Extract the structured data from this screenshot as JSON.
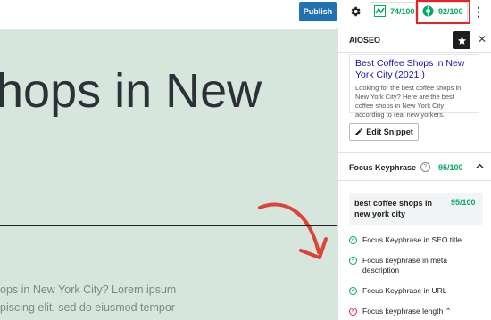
{
  "toolbar": {
    "publish_label": "Publish",
    "settings_icon": "gear-icon",
    "truseo_score": "74/100",
    "aioseo_score": "92/100",
    "more_icon": "kebab-icon",
    "highlight_color": "#e3242b"
  },
  "canvas": {
    "heading": "hops in New",
    "body_line1": "ops in New York City? Lorem ipsum",
    "body_line2": "piscing elit, sed do eiusmod tempor",
    "background_color": "#d7e6dc"
  },
  "sidebar": {
    "title": "AIOSEO",
    "snippet": {
      "title": "Best Coffee Shops in New York City (2021 )",
      "description": "Looking for the best coffee shops in New York City? Here are the best coffee shops in New York City according to real new yorkers."
    },
    "edit_snippet_label": "Edit Snippet",
    "focus_keyphrase": {
      "label": "Focus Keyphrase",
      "score": "95/100",
      "keyword": "best coffee shops in new york city",
      "keyword_score": "95/100",
      "checks": [
        {
          "text": "Focus Keyphrase in SEO title",
          "status": "pass"
        },
        {
          "text": "Focus keyphrase in meta description",
          "status": "pass"
        },
        {
          "text": "Focus Keyphrase in URL",
          "status": "pass"
        },
        {
          "text": "Focus keyphrase length",
          "status": "fail"
        }
      ]
    }
  },
  "colors": {
    "accent": "#2271b1",
    "good": "#00aa63",
    "bad": "#df2a4a"
  }
}
